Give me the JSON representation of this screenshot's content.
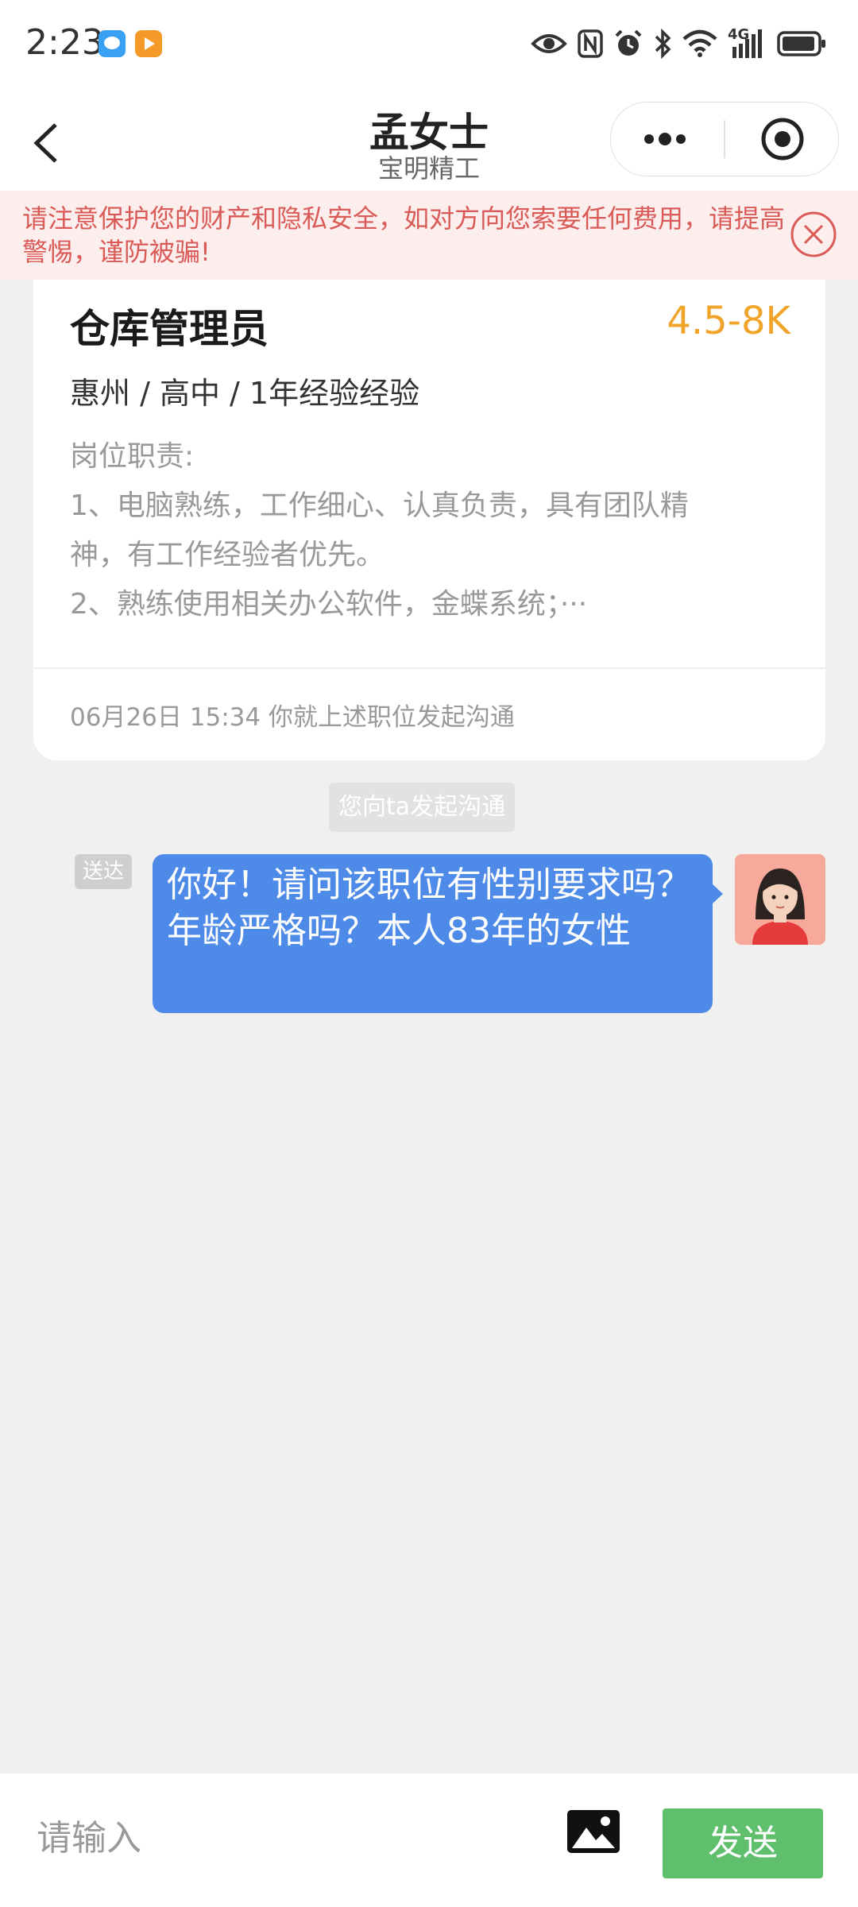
{
  "status_bar": {
    "time": "2:23",
    "network_label": "4G",
    "icons": [
      "chat-app-icon",
      "video-app-icon",
      "eye-icon",
      "nfc-icon",
      "alarm-icon",
      "bluetooth-icon",
      "wifi-icon",
      "signal-icon",
      "battery-icon"
    ]
  },
  "header": {
    "title": "孟女士",
    "subtitle": "宝明精工"
  },
  "warning": {
    "text": "请注意保护您的财产和隐私安全，如对方向您索要任何费用，请提高警惕，谨防被骗!"
  },
  "job_card": {
    "title": "仓库管理员",
    "salary": "4.5-8K",
    "meta": "惠州 / 高中 / 1年经验经验",
    "desc_heading": "岗位职责:",
    "desc_line1": "1、电脑熟练，工作细心、认真负责，具有团队精",
    "desc_line2": "神，有工作经验者优先。",
    "desc_line3": "2、熟练使用相关办公软件，金蝶系统；···",
    "footer": "06月26日 15:34 你就上述职位发起沟通"
  },
  "chat": {
    "system_tip": "您向ta发起沟通",
    "read_status": "送达",
    "message": "你好！请问该职位有性别要求吗？年龄严格吗？本人83年的女性"
  },
  "input_bar": {
    "placeholder": "请输入",
    "send_label": "发送"
  },
  "colors": {
    "accent_blue": "#4e8ae8",
    "salary_orange": "#f0a42a",
    "send_green": "#5fbf6d",
    "warning_red": "#d95a56",
    "warning_bg": "#fdeeee"
  }
}
